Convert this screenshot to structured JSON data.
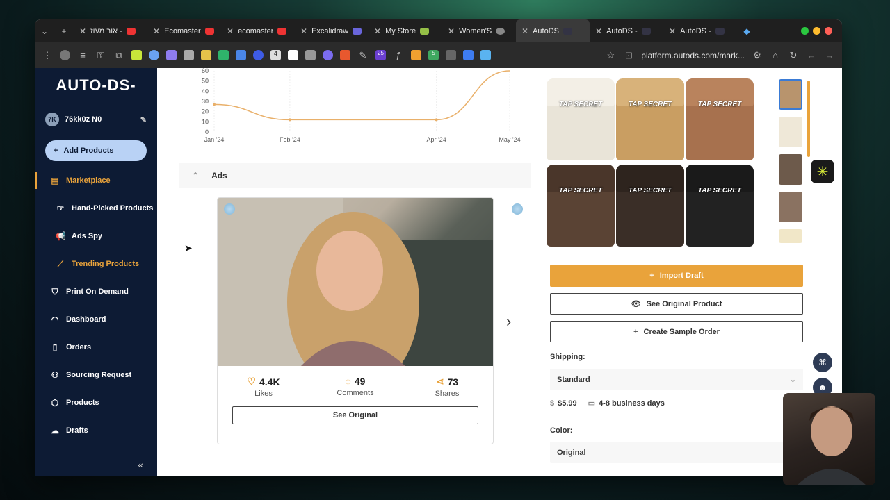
{
  "browser": {
    "tabs": [
      {
        "label": "אור מעוז -",
        "fav": "#e33"
      },
      {
        "label": "Ecomaster",
        "fav": "#e33"
      },
      {
        "label": "ecomaster",
        "fav": "#e33"
      },
      {
        "label": "Excalidraw",
        "fav": "#6965db"
      },
      {
        "label": "My Store",
        "fav": "#95bf47"
      },
      {
        "label": "Women'S",
        "fav": "#888"
      },
      {
        "label": "AutoDS",
        "fav": "#334"
      },
      {
        "label": "AutoDS -",
        "fav": "#334"
      },
      {
        "label": "AutoDS -",
        "fav": "#334"
      }
    ],
    "url": "platform.autods.com/mark...",
    "ext_badges": [
      "4",
      "25",
      "5"
    ]
  },
  "sidebar": {
    "logo": "AUTO-DS-",
    "user_initials": "7K",
    "user_name": "76kk0z N0",
    "add_products": "Add Products",
    "items": [
      {
        "label": "Marketplace"
      },
      {
        "label": "Hand-Picked Products"
      },
      {
        "label": "Ads Spy"
      },
      {
        "label": "Trending Products"
      },
      {
        "label": "Print On Demand"
      },
      {
        "label": "Dashboard"
      },
      {
        "label": "Orders"
      },
      {
        "label": "Sourcing Request"
      },
      {
        "label": "Products"
      },
      {
        "label": "Drafts"
      }
    ]
  },
  "chart_data": {
    "type": "line",
    "x": [
      "Jan '24",
      "Feb '24",
      "Apr '24",
      "May '24"
    ],
    "points": [
      {
        "x": "Jan '24",
        "y": 27
      },
      {
        "x": "Feb '24",
        "y": 12
      },
      {
        "x": "Apr '24",
        "y": 12
      },
      {
        "x": "May '24",
        "y": 60
      }
    ],
    "yticks": [
      "60",
      "50",
      "40",
      "30",
      "20",
      "10",
      "0"
    ],
    "ylim": [
      0,
      60
    ],
    "color": "#e9b06a"
  },
  "ads": {
    "header": "Ads",
    "likes_value": "4.4K",
    "likes_label": "Likes",
    "comments_value": "49",
    "comments_label": "Comments",
    "shares_value": "73",
    "shares_label": "Shares",
    "see_original": "See Original"
  },
  "product": {
    "jar_label": "TAP SECRET",
    "import_draft": "Import Draft",
    "see_original_product": "See Original Product",
    "create_sample_order": "Create Sample Order",
    "shipping_label": "Shipping:",
    "shipping_value": "Standard",
    "price": "$5.99",
    "delivery": "4-8 business days",
    "color_label": "Color:",
    "color_value": "Original"
  }
}
